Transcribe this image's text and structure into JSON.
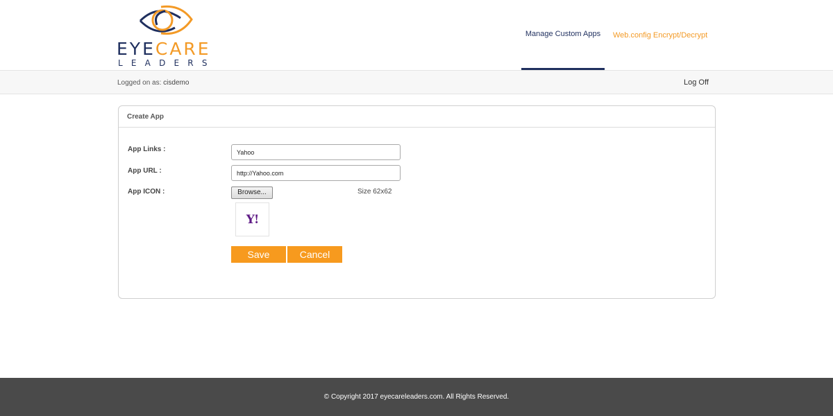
{
  "brand": {
    "logo_text_1a": "EYE",
    "logo_text_1b": "CARE",
    "logo_text_2": "LEADERS",
    "navy": "#1f2f5e",
    "orange": "#f39a26"
  },
  "nav": {
    "active": "Manage Custom Apps",
    "link": "Web.config Encrypt/Decrypt"
  },
  "status": {
    "logged_prefix": "Logged on as: ",
    "user": "cisdemo",
    "logoff": "Log Off"
  },
  "form": {
    "title": "Create App",
    "app_links_label": "App Links :",
    "app_links_value": "Yahoo",
    "app_url_label": "App URL :",
    "app_url_value": "http://Yahoo.com",
    "app_icon_label": "App ICON :",
    "browse_label": "Browse...",
    "size_hint": "Size 62x62",
    "icon_preview_text": "Y!",
    "save_label": "Save",
    "cancel_label": "Cancel",
    "button_color": "#f79a1e"
  },
  "footer": {
    "copyright": "© Copyright 2017 eyecareleaders.com. All Rights Reserved."
  }
}
